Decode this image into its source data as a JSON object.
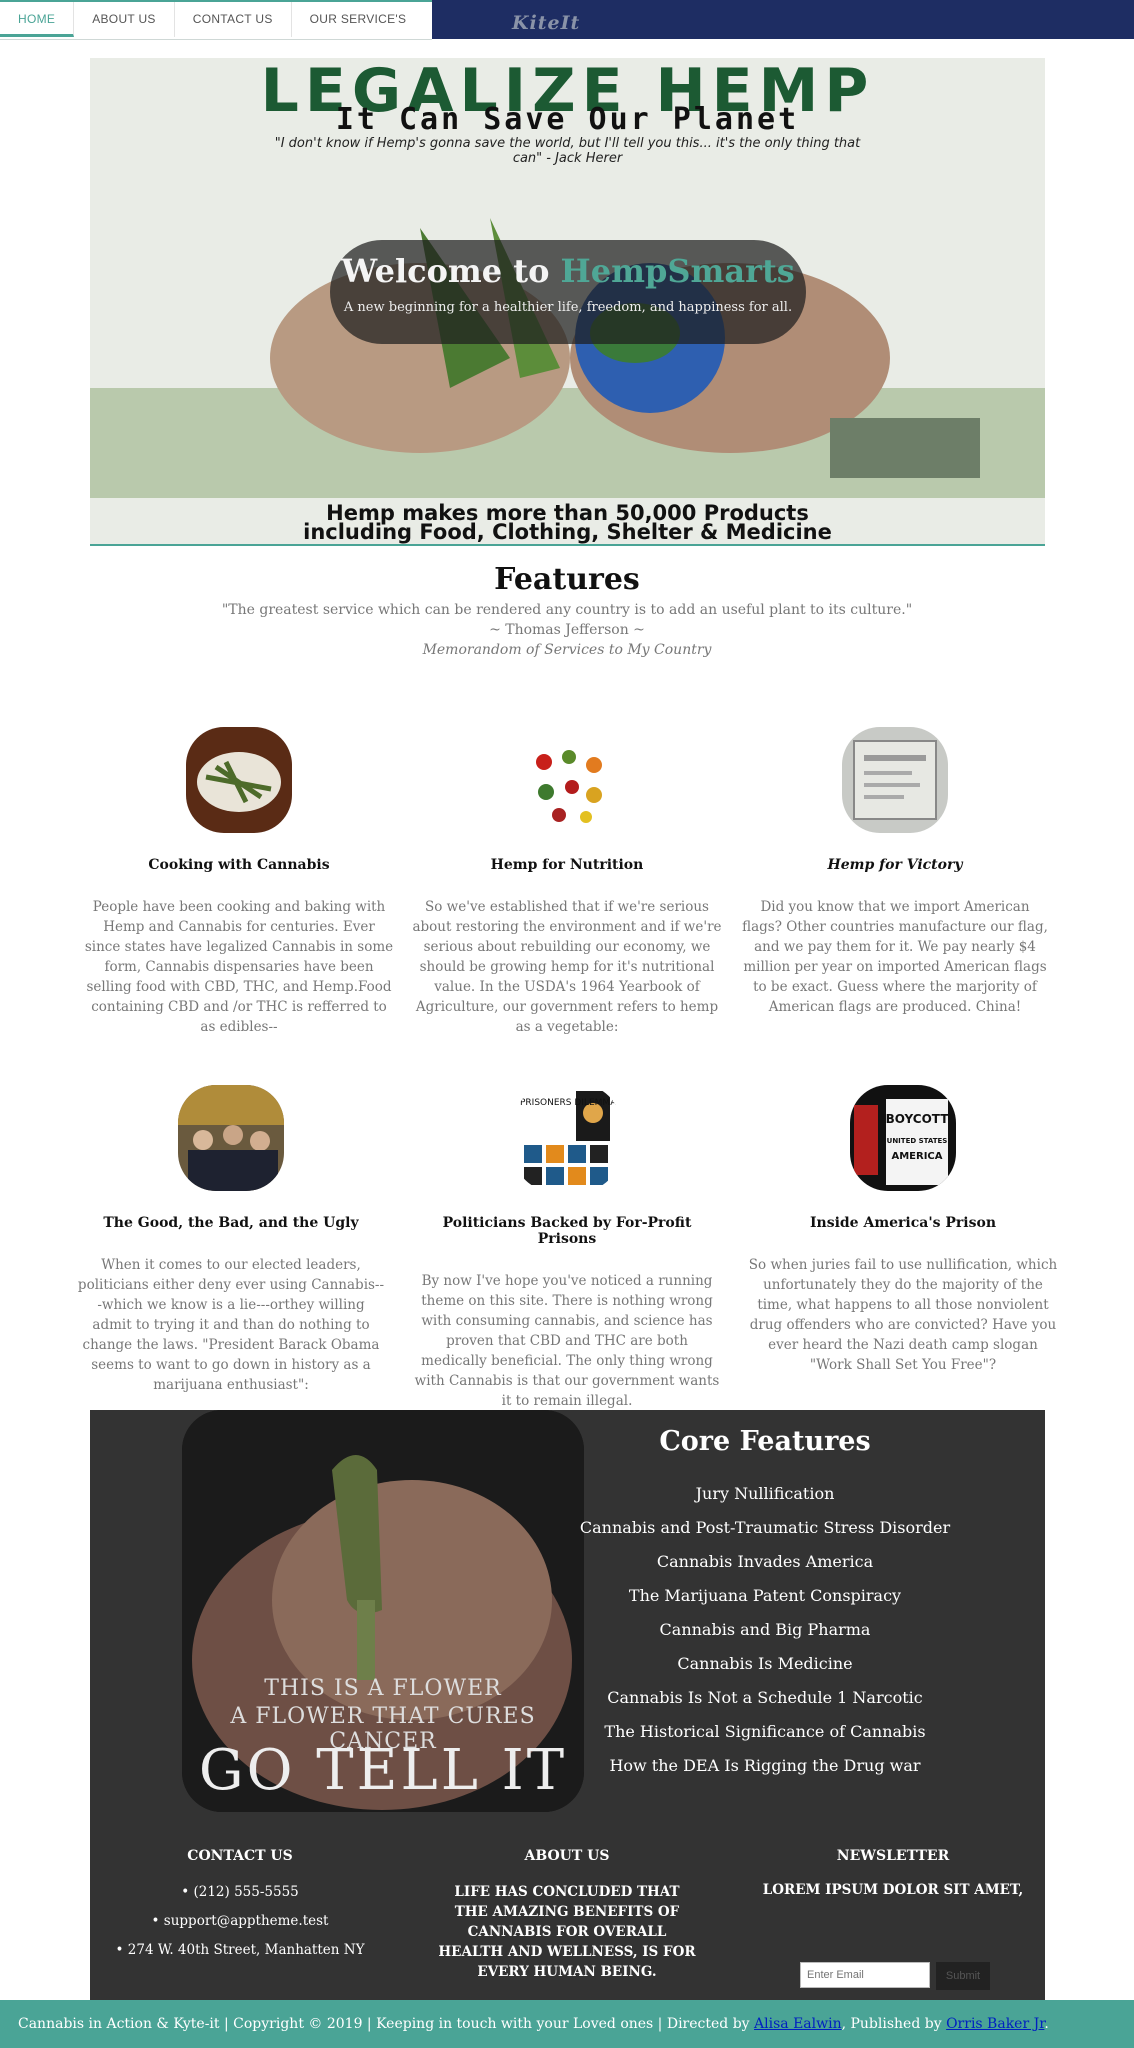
{
  "nav": {
    "items": [
      "HOME",
      "ABOUT US",
      "CONTACT US",
      "OUR SERVICE'S"
    ],
    "brand": "KiteIt"
  },
  "hero": {
    "poster_title": "LEGALIZE HEMP",
    "poster_subtitle": "It Can Save Our Planet",
    "poster_quote": "\"I don't know if Hemp's gonna save the world, but I'll tell you this... it's the only thing that can\" - Jack Herer",
    "poster_bottom_1": "Hemp makes more than 50,000 Products",
    "poster_bottom_2": "including Food, Clothing, Shelter & Medicine",
    "title_prefix": "Welcome to ",
    "title_accent": "HempSmarts",
    "tagline": "A new beginning for a healthier life, freedom, and happiness for all."
  },
  "features": {
    "title": "Features",
    "quote": "\"The greatest service which can be rendered any country is to add an useful plant to its culture.\"",
    "author": "~ Thomas Jefferson ~",
    "source": "Memorandom of Services to My Country",
    "cards": [
      {
        "title": "Cooking with Cannabis",
        "text": "People have been cooking and baking with Hemp and Cannabis for centuries. Ever since states have legalized Cannabis in some form, Cannabis dispensaries have been selling food with CBD, THC, and Hemp.Food containing CBD and /or THC is refferred to as edibles--"
      },
      {
        "title": "Hemp for Nutrition",
        "text": "So we've established that if we're serious about restoring the environment and if we're serious about rebuilding our economy, we should be growing hemp for it's nutritional value. In the USDA's 1964 Yearbook of Agriculture, our government refers to hemp as a vegetable:"
      },
      {
        "title": "Hemp for Victory",
        "text": "Did you know that we import American flags? Other countries manufacture our flag, and we pay them for it. We pay nearly $4 million per year on imported American flags to be exact. Guess where the marjority of American flags are produced. China!"
      },
      {
        "title": "The Good, the Bad, and the Ugly",
        "text": "When it comes to our elected leaders, politicians either deny ever using Cannabis---which we know is a lie---orthey willing admit to trying it and than do nothing to change the laws. \"President Barack Obama seems to want to go down in history as a marijuana enthusiast\":"
      },
      {
        "title": "Politicians Backed by For-Profit Prisons",
        "text": "By now I've hope you've noticed a running theme on this site. There is nothing wrong with consuming cannabis, and science has proven that CBD and THC are both medically beneficial. The only thing wrong with Cannabis is that our government wants it to remain illegal."
      },
      {
        "title": "Inside America's Prison",
        "text": "So when juries fail to use nullification, which unfortunately they do the majority of the time, what happens to all those nonviolent drug offenders who are convicted? Have you ever heard the Nazi death camp slogan \"Work Shall Set You Free\"?"
      }
    ],
    "thumb_texts": {
      "prisoners": "PRISONERS DILEMMA",
      "boycott_1": "BOYCOTT",
      "boycott_2": "UNITED STATES",
      "boycott_3": "AMERICA"
    }
  },
  "core": {
    "title": "Core Features",
    "image_line_1": "THIS IS A FLOWER",
    "image_line_2": "A FLOWER THAT CURES CANCER",
    "image_line_3": "GO TELL IT",
    "items": [
      "Jury Nullification",
      "Cannabis and Post-Traumatic Stress Disorder",
      "Cannabis Invades America",
      "The Marijuana Patent Conspiracy",
      "Cannabis and Big Pharma",
      "Cannabis Is Medicine",
      "Cannabis Is Not a Schedule 1 Narcotic",
      "The Historical Significance of Cannabis",
      "How the DEA Is Rigging the Drug war"
    ]
  },
  "footer": {
    "contact_title": "CONTACT US",
    "phone": "(212) 555-5555",
    "email": "support@apptheme.test",
    "address": "274 W. 40th Street, Manhatten NY",
    "about_title": "ABOUT US",
    "about_text": "LIFE HAS CONCLUDED THAT THE AMAZING BENEFITS OF CANNABIS FOR OVERALL HEALTH AND WELLNESS, IS FOR EVERY HUMAN BEING.",
    "newsletter_title": "NEWSLETTER",
    "newsletter_text": "LOREM IPSUM DOLOR SIT AMET,",
    "email_placeholder": "Enter Email",
    "submit_label": "Submit",
    "bar_text": "Cannabis in Action & Kyte-it | Copyright © 2019 | Keeping in touch with your Loved ones | Directed by ",
    "director": "Alisa Ealwin",
    "published_text": ", Published by ",
    "publisher": "Orris Baker Jr",
    "end": "."
  },
  "colors": {
    "accent": "#4aa496",
    "nav_dark": "#1e2d63",
    "core_bg": "#333333"
  }
}
